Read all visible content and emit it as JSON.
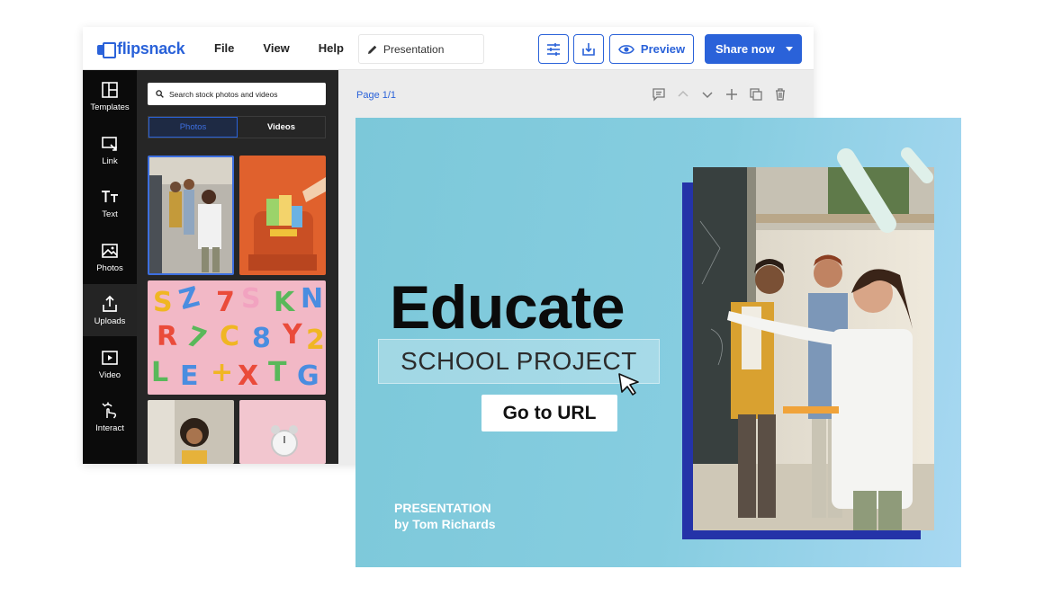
{
  "app": {
    "logo_text": "flipsnack",
    "menu": [
      "File",
      "View",
      "Help"
    ],
    "document_title": "Presentation",
    "preview_label": "Preview",
    "share_label": "Share now"
  },
  "toolrail": {
    "items": [
      {
        "label": "Templates",
        "icon": "templates-icon"
      },
      {
        "label": "Link",
        "icon": "link-icon"
      },
      {
        "label": "Text",
        "icon": "text-icon"
      },
      {
        "label": "Photos",
        "icon": "photos-icon"
      },
      {
        "label": "Uploads",
        "icon": "upload-icon"
      },
      {
        "label": "Video",
        "icon": "video-icon"
      },
      {
        "label": "Interact",
        "icon": "interact-icon"
      }
    ],
    "active": "Uploads"
  },
  "stock_panel": {
    "search_placeholder": "Search stock photos and videos",
    "tabs": [
      "Photos",
      "Videos"
    ],
    "active_tab": "Photos"
  },
  "canvas": {
    "page_label": "Page 1/1"
  },
  "slide": {
    "title": "Educate",
    "subtitle": "SCHOOL PROJECT",
    "button_label": "Go to URL",
    "author_line1": "PRESENTATION",
    "author_line2": "by Tom Richards"
  },
  "colors": {
    "accent": "#2a62d9",
    "rail": "#0b0b0b",
    "panel": "#262626",
    "slide_bg": "#86cde0",
    "photo_frame": "#2433a8"
  }
}
